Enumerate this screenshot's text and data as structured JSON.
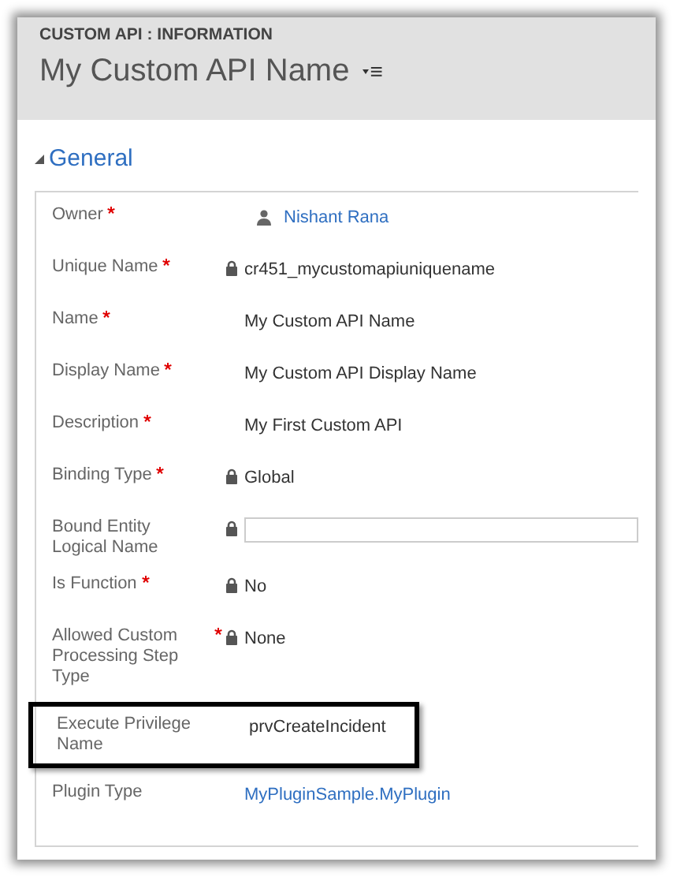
{
  "header": {
    "entity": "CUSTOM API : INFORMATION",
    "title": "My Custom API Name",
    "menu_glyph": "≡"
  },
  "section": {
    "title": "General",
    "expanded": true
  },
  "fields": [
    {
      "label": "Owner",
      "required": true,
      "locked": false,
      "kind": "owner",
      "value": "Nishant Rana",
      "highlighted": false
    },
    {
      "label": "Unique Name",
      "required": true,
      "locked": true,
      "kind": "text",
      "value": "cr451_mycustomapiuniquename",
      "highlighted": false
    },
    {
      "label": "Name",
      "required": true,
      "locked": false,
      "kind": "text",
      "value": "My Custom API Name",
      "highlighted": false
    },
    {
      "label": "Display Name",
      "required": true,
      "locked": false,
      "kind": "text",
      "value": "My Custom API Display Name",
      "highlighted": false
    },
    {
      "label": "Description",
      "required": true,
      "locked": false,
      "kind": "text",
      "value": "My First Custom API",
      "highlighted": false
    },
    {
      "label": "Binding Type",
      "required": true,
      "locked": true,
      "kind": "text",
      "value": "Global",
      "highlighted": false
    },
    {
      "label": "Bound Entity Logical Name",
      "required": false,
      "locked": true,
      "kind": "input",
      "highlighted": false
    },
    {
      "label": "Is Function",
      "required": true,
      "locked": true,
      "kind": "text",
      "value": "No",
      "highlighted": false
    },
    {
      "label": "Allowed Custom Processing Step Type",
      "required": true,
      "locked": true,
      "kind": "text",
      "value": "None",
      "highlighted": false
    },
    {
      "label": "Execute Privilege Name",
      "required": false,
      "locked": false,
      "kind": "text",
      "value": "prvCreateIncident",
      "highlighted": true
    },
    {
      "label": "Plugin Type",
      "required": false,
      "locked": false,
      "kind": "link",
      "value": "MyPluginSample.MyPlugin",
      "highlighted": false
    }
  ]
}
